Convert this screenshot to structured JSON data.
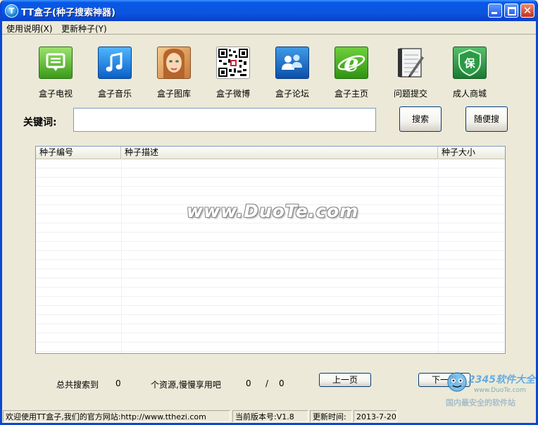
{
  "window": {
    "title": "TT盒子(种子搜索神器)",
    "app_icon_letter": "T"
  },
  "menu": [
    {
      "label": "使用说明(X)"
    },
    {
      "label": "更新种子(Y)"
    }
  ],
  "toolbar": [
    {
      "label": "盒子电视",
      "icon": "tv-icon"
    },
    {
      "label": "盒子音乐",
      "icon": "music-icon"
    },
    {
      "label": "盒子图库",
      "icon": "gallery-icon"
    },
    {
      "label": "盒子微博",
      "icon": "qr-code-icon"
    },
    {
      "label": "盒子论坛",
      "icon": "forum-icon"
    },
    {
      "label": "盒子主页",
      "icon": "ie-home-icon"
    },
    {
      "label": "问题提交",
      "icon": "notebook-icon"
    },
    {
      "label": "成人商城",
      "icon": "shield-icon",
      "glyph": "保"
    }
  ],
  "search": {
    "label": "关键词:",
    "value": "",
    "search_button": "搜索",
    "random_button": "随便搜"
  },
  "table": {
    "columns": [
      "种子编号",
      "种子描述",
      "种子大小"
    ],
    "rows": []
  },
  "watermark": "www.DuoTe.com",
  "stats": {
    "total_label": "总共搜索到",
    "total_count": "0",
    "resource_text": "个资源,慢慢享用吧",
    "current_page": "0",
    "page_sep": "/",
    "total_pages": "0",
    "prev_button": "上一页",
    "next_button": "下一页"
  },
  "statusbar": {
    "welcome": "欢迎使用TT盒子,我们的官方网站:http://www.tthezi.com",
    "version": "当前版本号:V1.8",
    "update_label": "更新时间:",
    "update_date": "2013-7-20"
  },
  "overlay_logo": {
    "brand": "2345软件大全",
    "url": "www.DuoTe.com",
    "slogan": "国内最安全的软件站"
  },
  "colors": {
    "titlebar": "#0a56e0",
    "window_bg": "#ece9d8",
    "table_border": "#7f9db9"
  }
}
